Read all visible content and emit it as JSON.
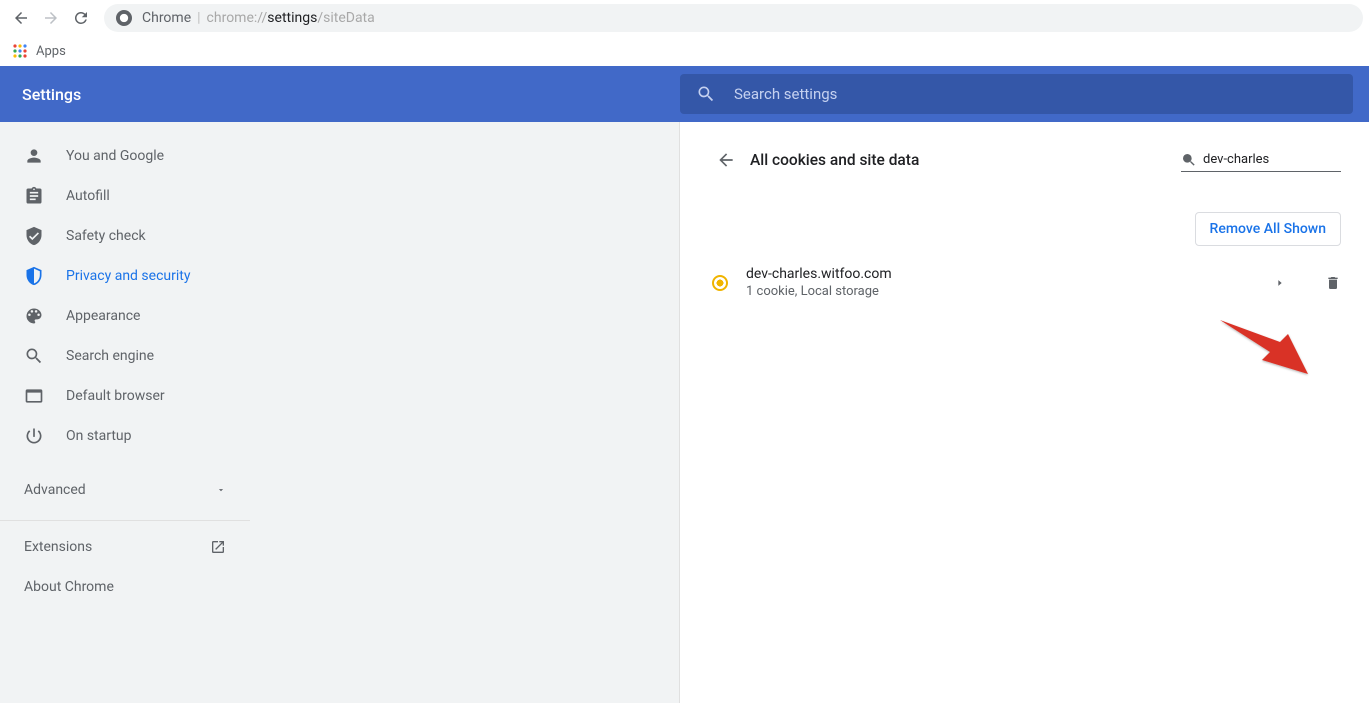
{
  "toolbar": {
    "omnibox_brand": "Chrome",
    "url_scheme": "chrome://",
    "url_highlight": "settings",
    "url_rest": "/siteData"
  },
  "bookmarks": {
    "apps_label": "Apps"
  },
  "header": {
    "title": "Settings",
    "search_placeholder": "Search settings"
  },
  "sidebar": {
    "items": [
      {
        "label": "You and Google"
      },
      {
        "label": "Autofill"
      },
      {
        "label": "Safety check"
      },
      {
        "label": "Privacy and security"
      },
      {
        "label": "Appearance"
      },
      {
        "label": "Search engine"
      },
      {
        "label": "Default browser"
      },
      {
        "label": "On startup"
      }
    ],
    "advanced_label": "Advanced",
    "extensions_label": "Extensions",
    "about_label": "About Chrome"
  },
  "panel": {
    "title": "All cookies and site data",
    "filter_value": "dev-charles",
    "remove_all_label": "Remove All Shown",
    "site": {
      "domain": "dev-charles.witfoo.com",
      "detail": "1 cookie, Local storage"
    }
  }
}
